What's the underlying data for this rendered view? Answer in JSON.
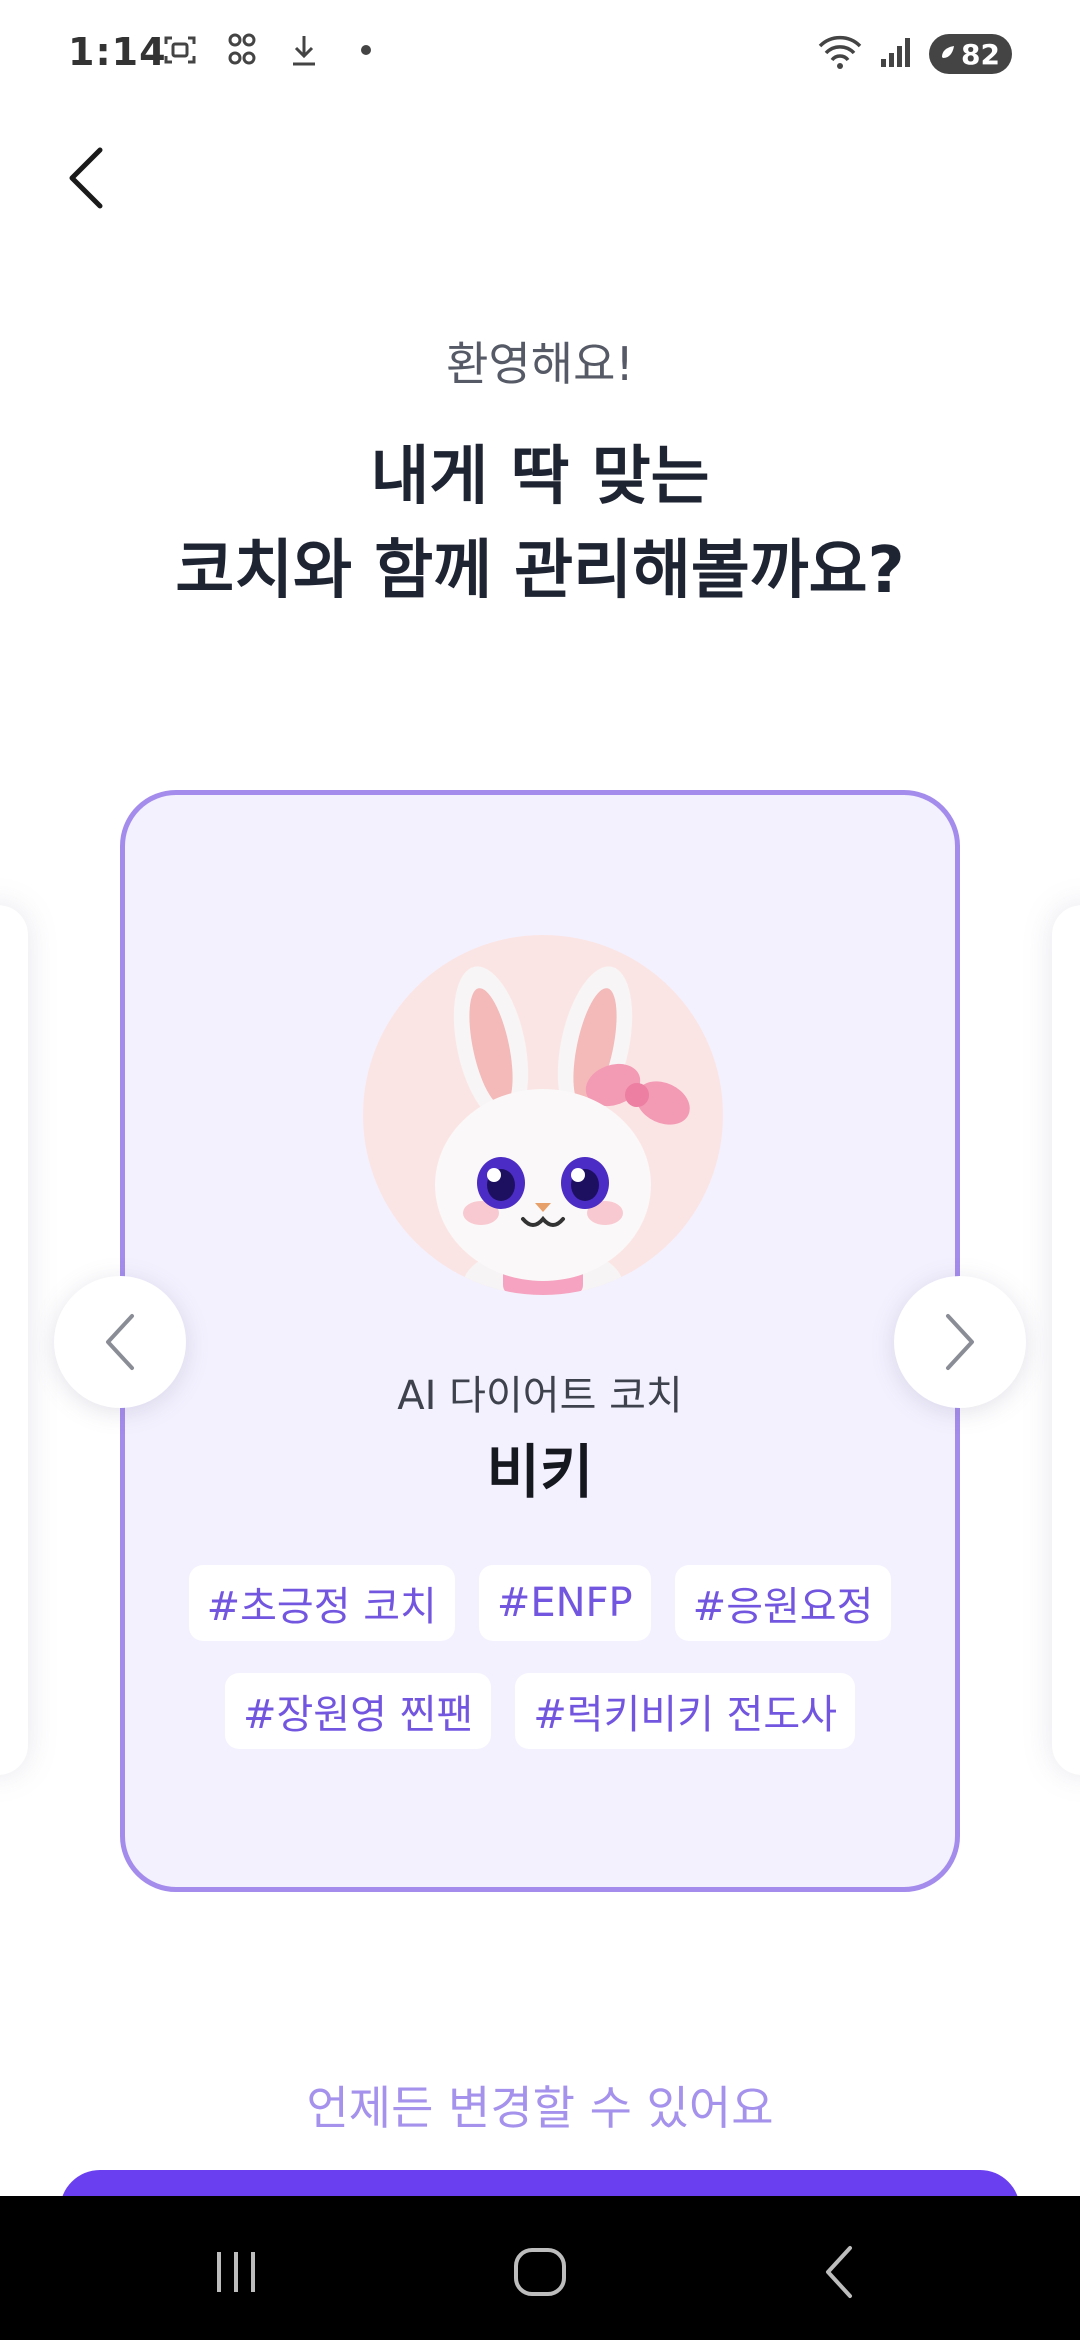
{
  "status_bar": {
    "time": "1:14",
    "battery": "82",
    "icons": [
      "screenshot-icon",
      "qr-icon",
      "download-icon",
      "dot-icon",
      "wifi-icon",
      "signal-icon",
      "battery-icon"
    ]
  },
  "header": {
    "back_icon": "chevron-left-icon"
  },
  "intro": {
    "welcome": "환영해요!",
    "title_line1": "내게 딱 맞는",
    "title_line2": "코치와 함께 관리해볼까요?"
  },
  "coach": {
    "subtitle": "AI 다이어트 코치",
    "name": "비키",
    "avatar": "bunny-avatar",
    "tags_row1": [
      "#초긍정 코치",
      "#ENFP",
      "#응원요정"
    ],
    "tags_row2": [
      "#장원영 찐팬",
      "#럭키비키 전도사"
    ]
  },
  "carousel": {
    "prev_icon": "chevron-left-icon",
    "next_icon": "chevron-right-icon"
  },
  "footer": {
    "change_note": "언제든 변경할 수 있어요"
  },
  "colors": {
    "accent": "#6a3ff0",
    "card_border": "#a48cec",
    "card_bg": "#f3f1fe",
    "tag_text": "#7356e0",
    "note_text": "#a592ec"
  }
}
